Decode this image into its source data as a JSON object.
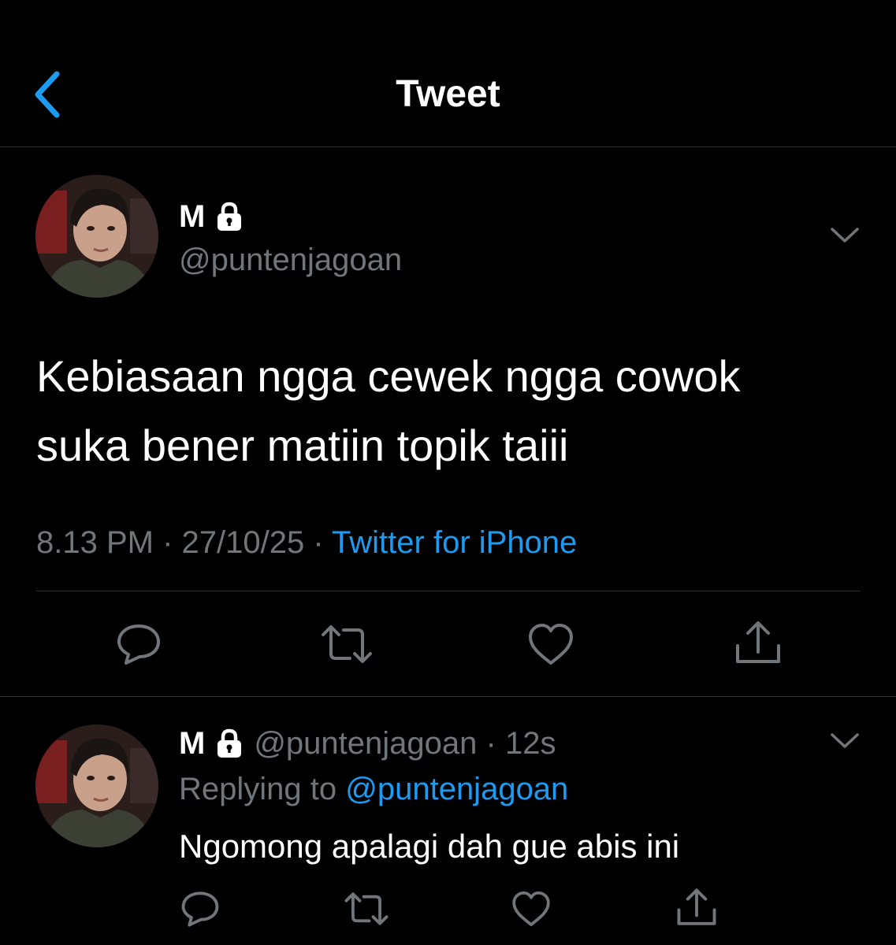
{
  "header": {
    "title": "Tweet",
    "back_icon": "chevron-left-icon",
    "accent_color": "#1d9bf0"
  },
  "tweet": {
    "display_name": "M",
    "protected_icon": "lock-icon",
    "handle": "@puntenjagoan",
    "text_lines": [
      "Kebiasaan ngga cewek ngga cowok",
      "suka bener matiin topik taiii"
    ],
    "time": "8.13 PM",
    "separator": " · ",
    "date": "27/10/25",
    "source": "Twitter for iPhone",
    "actions": [
      "reply-icon",
      "retweet-icon",
      "like-icon",
      "share-icon"
    ]
  },
  "reply": {
    "display_name": "M",
    "handle": "@puntenjagoan",
    "separator": " · ",
    "time_ago": "12s",
    "replying_label": "Replying to ",
    "replying_to": "@puntenjagoan",
    "text": "Ngomong apalagi dah gue abis ini",
    "actions": [
      "reply-icon",
      "retweet-icon",
      "like-icon",
      "share-icon"
    ]
  },
  "colors": {
    "background": "#000000",
    "text": "#ffffff",
    "secondary_text": "#71767b",
    "link": "#1d9bf0",
    "divider": "#2f3336"
  }
}
